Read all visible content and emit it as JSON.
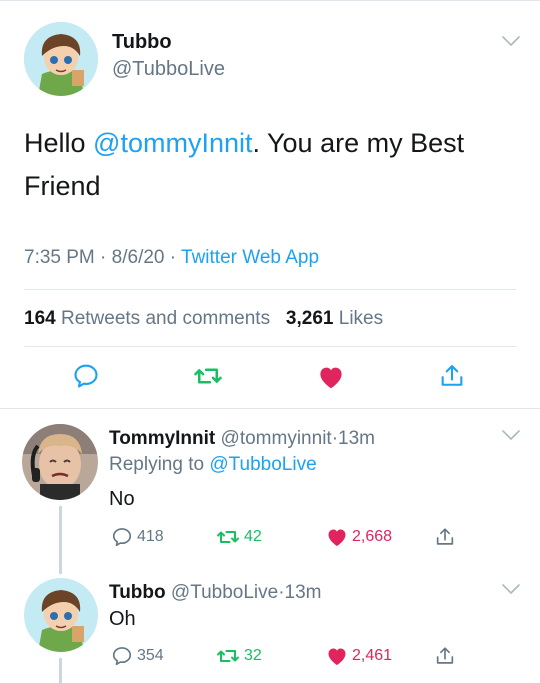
{
  "colors": {
    "accent": "#1da1f2",
    "retweet": "#17bf63",
    "like": "#e0245e",
    "muted": "#657786",
    "text": "#14171a",
    "divider": "#e1e8ed"
  },
  "main_tweet": {
    "display_name": "Tubbo",
    "handle": "@TubboLive",
    "text_before": "Hello ",
    "mention": "@tommyInnit",
    "text_after_line1": ". You are my Best",
    "text_line2": "Friend",
    "time": "7:35 PM",
    "sep1": "·",
    "date": "8/6/20",
    "sep2": "·",
    "source": "Twitter Web App",
    "retweets_count": "164",
    "retweets_label": "Retweets and comments",
    "likes_count": "3,261",
    "likes_label": "Likes",
    "icons": [
      "reply-icon",
      "retweet-icon",
      "like-icon-filled",
      "share-icon"
    ]
  },
  "replies": [
    {
      "display_name": "TommyInnit",
      "handle": "@tommyinnit",
      "sep": "·",
      "time": "13m",
      "replying_prefix": "Replying to",
      "replying_handle": "@TubboLive",
      "text": "No",
      "reply_count": "418",
      "retweet_count": "42",
      "like_count": "2,668"
    },
    {
      "display_name": "Tubbo",
      "handle": "@TubboLive",
      "sep": "·",
      "time": "13m",
      "text": "Oh",
      "reply_count": "354",
      "retweet_count": "32",
      "like_count": "2,461"
    }
  ]
}
